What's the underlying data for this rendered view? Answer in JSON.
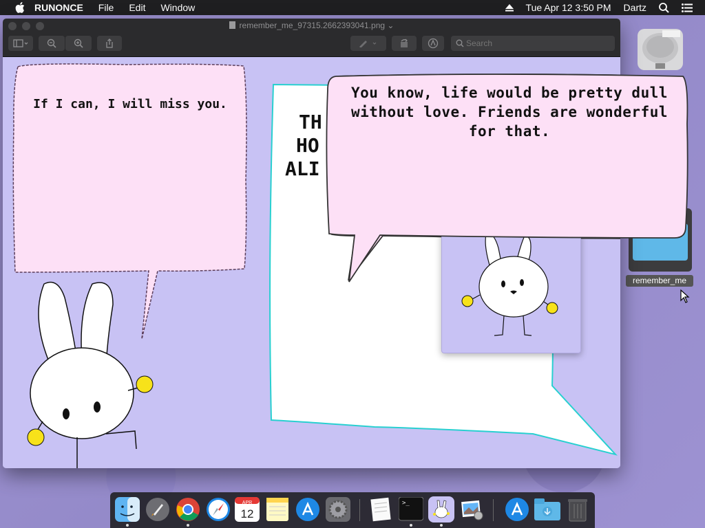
{
  "menubar": {
    "app_name": "RUNONCE",
    "items": [
      "File",
      "Edit",
      "Window"
    ],
    "clock": "Tue Apr 12  3:50 PM",
    "user": "Dartz"
  },
  "window": {
    "title": "remember_me_97315.2662393041.png",
    "search_placeholder": "Search"
  },
  "comic": {
    "bubble_left": "If I can, I will miss you.",
    "bubble_right": "You know, life would be pretty dull without love. Friends are wonderful for that.",
    "partial_text_lines": [
      "TH",
      "HO",
      "ALI"
    ]
  },
  "desktop": {
    "folder_label": "remember_me"
  },
  "dock": {
    "items": [
      "finder",
      "launchpad",
      "chrome",
      "safari",
      "calendar",
      "notes",
      "app-store",
      "system-preferences",
      "textedit",
      "terminal",
      "preview-bunny",
      "preview",
      "app-store-2",
      "downloads",
      "trash"
    ],
    "calendar_month": "APR",
    "calendar_day": "12",
    "terminal_prompt": ">_"
  },
  "colors": {
    "bubble_pink": "#fde0f6",
    "page_lavender": "#c8c2f4",
    "bunny_yellow": "#f7e21a"
  }
}
